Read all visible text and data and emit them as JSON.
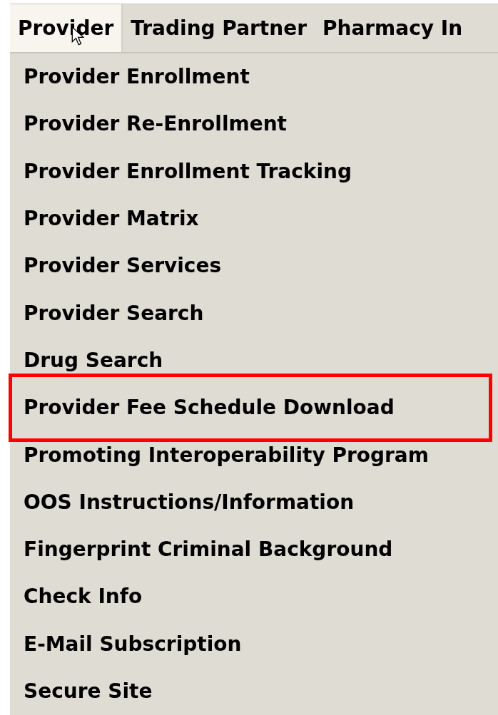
{
  "menu_bar": [
    {
      "label": "Provider",
      "selected": true
    },
    {
      "label": "Trading Partner",
      "selected": false
    },
    {
      "label": "Pharmacy In",
      "selected": false
    }
  ],
  "dropdown": {
    "items": [
      {
        "label": "Provider Enrollment",
        "outlined": false
      },
      {
        "label": "Provider Re-Enrollment",
        "outlined": false
      },
      {
        "label": "Provider Enrollment Tracking",
        "outlined": false
      },
      {
        "label": "Provider Matrix",
        "outlined": false
      },
      {
        "label": "Provider Services",
        "outlined": false
      },
      {
        "label": "Provider Search",
        "outlined": false
      },
      {
        "label": "Drug Search",
        "outlined": false
      },
      {
        "label": "Provider Fee Schedule Download",
        "outlined": true
      },
      {
        "label": "Promoting Interoperability Program",
        "outlined": false
      },
      {
        "label": "OOS Instructions/Information",
        "outlined": false
      },
      {
        "label": "Fingerprint Criminal Background",
        "outlined": false
      },
      {
        "label": "Check Info",
        "outlined": false
      },
      {
        "label": "E-Mail Subscription",
        "outlined": false
      },
      {
        "label": "Secure Site",
        "outlined": false
      }
    ]
  }
}
